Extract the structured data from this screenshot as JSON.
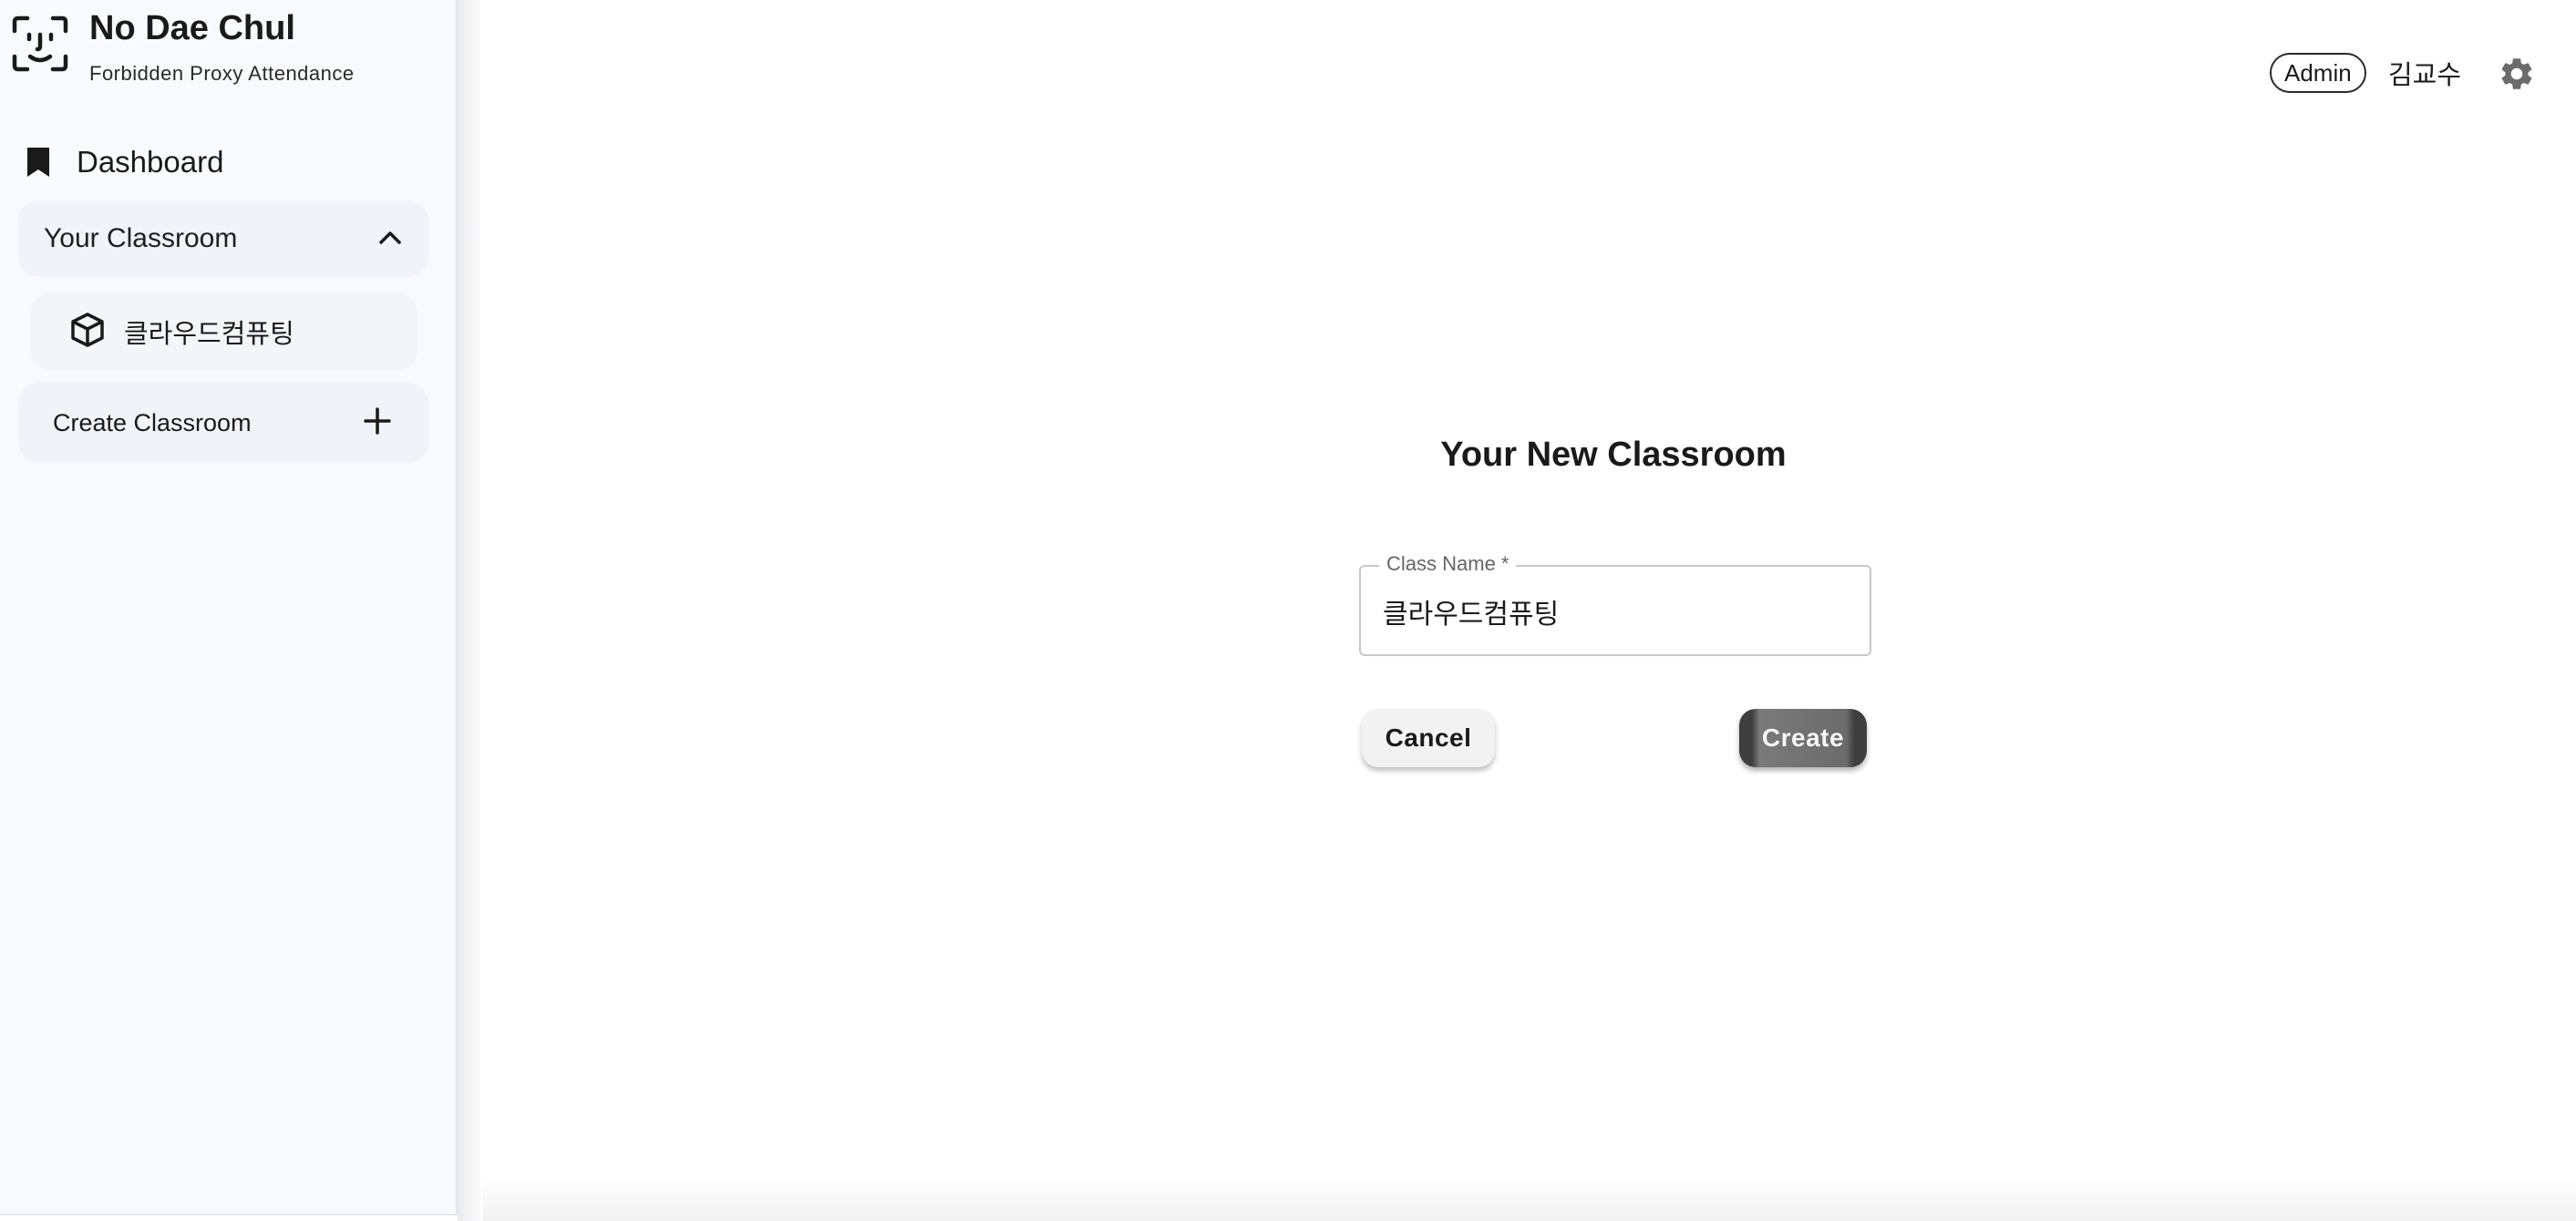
{
  "brand": {
    "title": "No Dae Chul",
    "subtitle": "Forbidden Proxy Attendance",
    "icon": "face-id-icon"
  },
  "sidebar": {
    "dashboard": {
      "label": "Dashboard",
      "icon": "bookmark-icon"
    },
    "classroom_group": {
      "label": "Your Classroom",
      "expanded": true,
      "items": [
        {
          "label": "클라우드컴퓨팅",
          "icon": "cube-icon"
        }
      ]
    },
    "create": {
      "label": "Create Classroom",
      "icon": "plus-icon"
    }
  },
  "header": {
    "role_badge": "Admin",
    "user_name": "김교수",
    "settings_icon": "gear-icon"
  },
  "form": {
    "title": "Your New Classroom",
    "class_name_label": "Class Name *",
    "class_name_value": "클라우드컴퓨팅",
    "cancel_label": "Cancel",
    "create_label": "Create"
  },
  "colors": {
    "sidebar_bg": "#f9fafd",
    "group_bg": "#f0f3fa",
    "create_button_bg": "#6b6b6b"
  }
}
